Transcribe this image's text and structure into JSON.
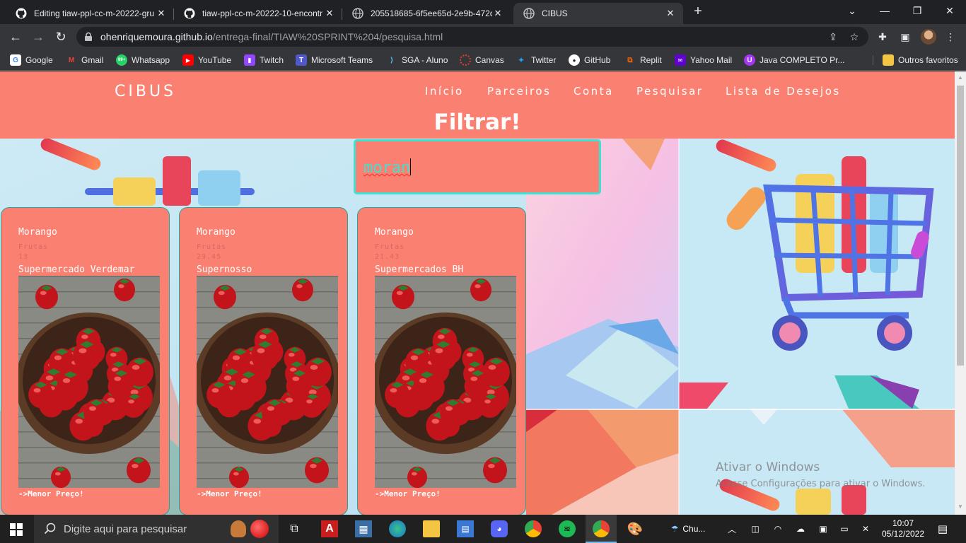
{
  "browser": {
    "tabs": [
      {
        "title": "Editing tiaw-ppl-cc-m-20222-gru",
        "icon": "github-icon"
      },
      {
        "title": "tiaw-ppl-cc-m-20222-10-encontr",
        "icon": "github-icon"
      },
      {
        "title": "205518685-6f5ee65d-2e9b-472d",
        "icon": "globe-icon"
      },
      {
        "title": "CIBUS",
        "icon": "globe-icon",
        "active": true
      }
    ],
    "new_tab": "+",
    "url_host": "ohenriquemoura.github.io",
    "url_path": "/entrega-final/TIAW%20SPRINT%204/pesquisa.html",
    "bookmarks": [
      {
        "label": "Google",
        "icon": "google-icon",
        "color": "#4285f4"
      },
      {
        "label": "Gmail",
        "icon": "gmail-icon",
        "color": "#ea4335"
      },
      {
        "label": "Whatsapp",
        "icon": "whatsapp-icon",
        "color": "#25d366",
        "badge": "99+"
      },
      {
        "label": "YouTube",
        "icon": "youtube-icon",
        "color": "#ff0000"
      },
      {
        "label": "Twitch",
        "icon": "twitch-icon",
        "color": "#9146ff"
      },
      {
        "label": "Microsoft Teams",
        "icon": "teams-icon",
        "color": "#5059c9"
      },
      {
        "label": "SGA - Aluno",
        "icon": "sga-icon",
        "color": "#1e88e5"
      },
      {
        "label": "Canvas",
        "icon": "canvas-icon",
        "color": "#e13f2b"
      },
      {
        "label": "Twitter",
        "icon": "twitter-icon",
        "color": "#1da1f2"
      },
      {
        "label": "GitHub",
        "icon": "github-icon",
        "color": "#ffffff"
      },
      {
        "label": "Replit",
        "icon": "replit-icon",
        "color": "#f26207"
      },
      {
        "label": "Yahoo Mail",
        "icon": "yahoo-icon",
        "color": "#6001d2"
      },
      {
        "label": "Java COMPLETO Pr...",
        "icon": "udemy-icon",
        "color": "#a435f0"
      },
      {
        "label": "Outros favoritos",
        "icon": "folder-icon",
        "color": "#f4c542"
      }
    ]
  },
  "site": {
    "brand": "CIBUS",
    "nav": [
      "Início",
      "Parceiros",
      "Conta",
      "Pesquisar",
      "Lista de Desejos"
    ],
    "filter_title": "Filtrar!",
    "search_value": "moran",
    "accent": "#fa8072",
    "border_accent": "#40e0d0"
  },
  "cards": [
    {
      "name": "Morango",
      "category": "Frutas",
      "price": "13",
      "store": "Supermercado Verdemar",
      "link": "->Menor Preço!"
    },
    {
      "name": "Morango",
      "category": "Frutas",
      "price": "29.45",
      "store": "Supernosso",
      "link": "->Menor Preço!"
    },
    {
      "name": "Morango",
      "category": "Frutas",
      "price": "21.43",
      "store": "Supermercados BH",
      "link": "->Menor Preço!"
    }
  ],
  "watermark": {
    "title": "Ativar o Windows",
    "subtitle": "Acesse Configurações para ativar o Windows."
  },
  "taskbar": {
    "search_placeholder": "Digite aqui para pesquisar",
    "weather": "Chu...",
    "time": "10:07",
    "date": "05/12/2022"
  }
}
